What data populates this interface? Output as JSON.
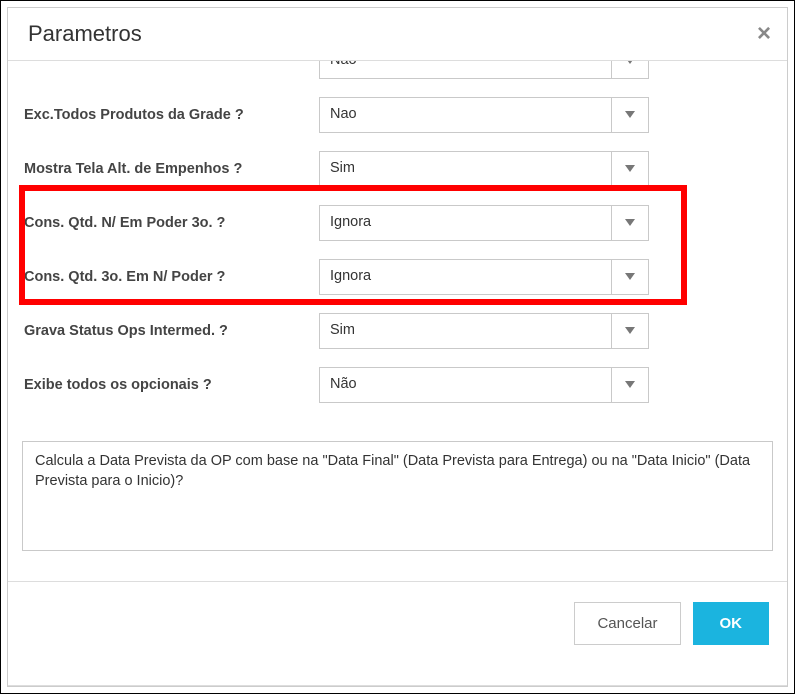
{
  "dialog": {
    "title": "Parametros",
    "close_symbol": "×"
  },
  "params": {
    "row0": {
      "label": "",
      "value": "Nao"
    },
    "row1": {
      "label": "Exc.Todos Produtos da Grade ?",
      "value": "Nao"
    },
    "row2": {
      "label": "Mostra Tela Alt. de Empenhos ?",
      "value": "Sim"
    },
    "row3": {
      "label": "Cons. Qtd. N/ Em Poder 3o. ?",
      "value": "Ignora"
    },
    "row4": {
      "label": "Cons. Qtd. 3o. Em N/ Poder ?",
      "value": "Ignora"
    },
    "row5": {
      "label": "Grava Status Ops Intermed. ?",
      "value": "Sim"
    },
    "row6": {
      "label": "Exibe todos os opcionais ?",
      "value": "Não"
    }
  },
  "description": "Calcula a Data Prevista da OP com base na \"Data Final\" (Data Prevista para Entrega) ou na \"Data Inicio\" (Data Prevista para o Inicio)?",
  "footer": {
    "cancel_label": "Cancelar",
    "ok_label": "OK"
  }
}
